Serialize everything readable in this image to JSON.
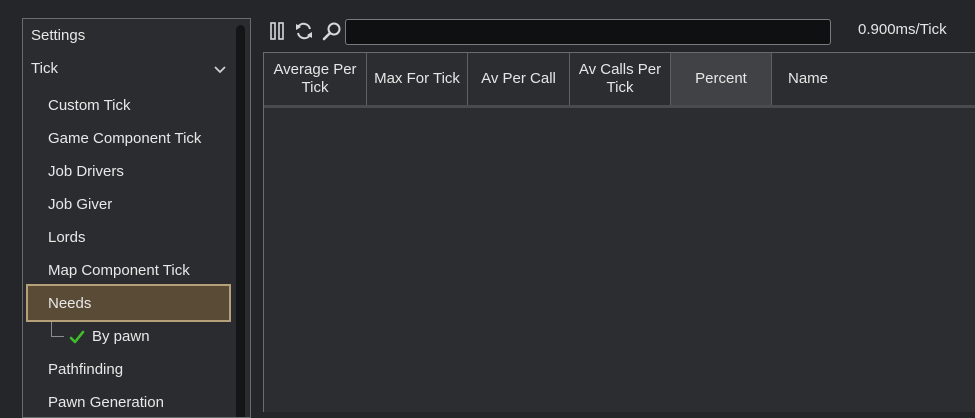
{
  "sidebar": {
    "settings_label": "Settings",
    "tick_label": "Tick",
    "items": [
      {
        "label": "Custom Tick"
      },
      {
        "label": "Game Component Tick"
      },
      {
        "label": "Job Drivers"
      },
      {
        "label": "Job Giver"
      },
      {
        "label": "Lords"
      },
      {
        "label": "Map Component Tick"
      },
      {
        "label": "Needs",
        "selected": true
      },
      {
        "label": "By pawn",
        "checked": true
      },
      {
        "label": "Pathfinding"
      },
      {
        "label": "Pawn Generation"
      }
    ]
  },
  "toolbar": {
    "pause_icon": "pause-icon",
    "refresh_icon": "refresh-icon",
    "search_icon": "search-icon",
    "search_value": "",
    "tick_readout": "0.900ms/Tick"
  },
  "table": {
    "columns": [
      {
        "label": "Average Per Tick"
      },
      {
        "label": "Max For Tick"
      },
      {
        "label": "Av Per Call"
      },
      {
        "label": "Av Calls Per Tick"
      },
      {
        "label": "Percent",
        "active": true
      },
      {
        "label": "Name"
      }
    ],
    "rows": []
  },
  "colors": {
    "selected_bg": "#5a4b36",
    "selected_border": "#b5a07a",
    "check": "#3fbf2a"
  }
}
